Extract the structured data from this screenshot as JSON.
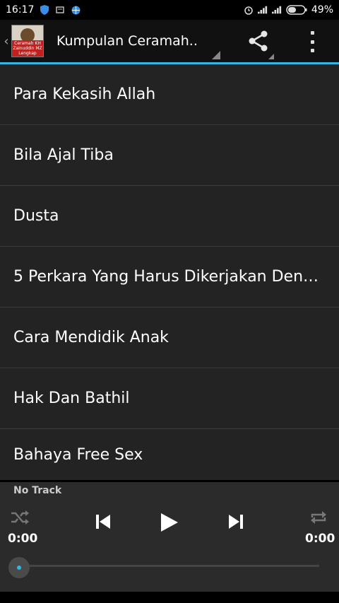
{
  "status": {
    "time": "16:17",
    "battery": "49%",
    "left_icons": [
      "shield-icon",
      "message-icon",
      "globe-icon"
    ],
    "right_icons": [
      "alarm-icon",
      "signal-icon",
      "signal-icon",
      "battery-icon"
    ]
  },
  "actionbar": {
    "title": "Kumpulan Ceramah..",
    "app_icon_text": "Ceramah KH Zainuddin MZ Lengkap"
  },
  "list": {
    "items": [
      "Para Kekasih Allah",
      "Bila Ajal Tiba",
      "Dusta",
      "5 Perkara Yang Harus Dikerjakan Deng...",
      "Cara Mendidik Anak",
      "Hak Dan Bathil",
      "Bahaya Free Sex"
    ]
  },
  "player": {
    "track": "No Track",
    "elapsed": "0:00",
    "duration": "0:00",
    "progress": 0
  },
  "colors": {
    "accent": "#33b5e5",
    "list_bg": "#232323",
    "player_bg": "#2b2b2b"
  }
}
